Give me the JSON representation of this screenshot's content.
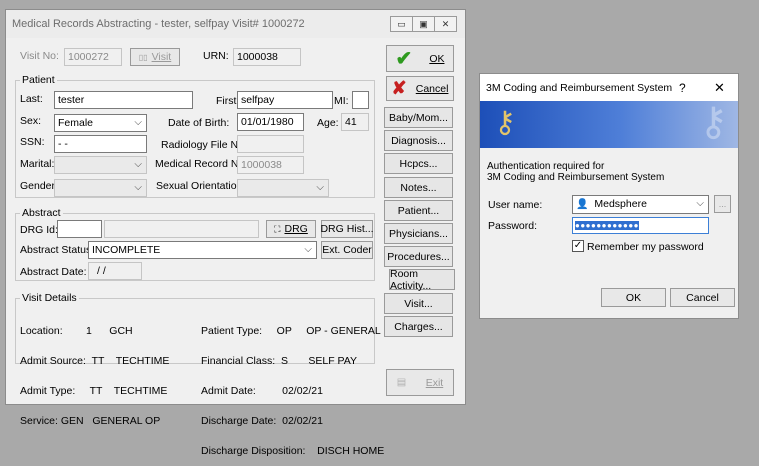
{
  "main_window": {
    "title": "Medical Records Abstracting - tester, selfpay  Visit# 1000272",
    "visit_no_label": "Visit No:",
    "visit_no_value": "1000272",
    "visit_button": "Visit",
    "urn_label": "URN:",
    "urn_value": "1000038",
    "patient": {
      "group_label": "Patient",
      "last_label": "Last:",
      "last_value": "tester",
      "first_label": "First:",
      "first_value": "selfpay",
      "mi_label": "MI:",
      "mi_value": "",
      "sex_label": "Sex:",
      "sex_value": "Female",
      "dob_label": "Date of Birth:",
      "dob_value": "01/01/1980",
      "age_label": "Age:",
      "age_value": "41",
      "ssn_label": "SSN:",
      "ssn_value": "- -",
      "radiology_label": "Radiology File No:",
      "radiology_value": "",
      "marital_label": "Marital:",
      "mrn_label": "Medical Record No:",
      "mrn_value": "1000038",
      "gender_label": "Gender:",
      "orientation_label": "Sexual Orientation:"
    },
    "abstract": {
      "group_label": "Abstract",
      "drg_id_label": "DRG Id:",
      "drg_button": "DRG",
      "drg_hist_button": "DRG Hist...",
      "status_label": "Abstract Status:",
      "status_value": "INCOMPLETE",
      "ext_coder_button": "Ext. Coder",
      "date_label": "Abstract Date:",
      "date_value": "/ /"
    },
    "visit_details": {
      "group_label": "Visit Details",
      "left_lines": [
        "Location:        1      GCH",
        "Admit Source:  TT    TECHTIME",
        "Admit Type:     TT    TECHTIME",
        "Service: GEN   GENERAL OP"
      ],
      "right_lines": [
        "Patient Type:     OP     OP - GENERAL",
        "Financial Class:  S       SELF PAY",
        "Admit Date:         02/02/21",
        "Discharge Date:  02/02/21",
        "Discharge Disposition:    DISCH HOME"
      ]
    },
    "side_buttons": {
      "ok": "OK",
      "cancel": "Cancel",
      "baby_mom": "Baby/Mom...",
      "diagnosis": "Diagnosis...",
      "hcpcs": "Hcpcs...",
      "notes": "Notes...",
      "patient": "Patient...",
      "physicians": "Physicians...",
      "procedures": "Procedures...",
      "room_activity": "Room Activity...",
      "visit": "Visit...",
      "charges": "Charges...",
      "exit": "Exit"
    }
  },
  "dialog": {
    "title": "3M Coding and Reimbursement System",
    "help": "?",
    "close": "✕",
    "message_line1": "Authentication required for",
    "message_line2": "3M Coding and Reimbursement System",
    "username_label": "User name:",
    "username_value": "Medsphere",
    "browse_button": "...",
    "password_label": "Password:",
    "password_value": "●●●●●●●●●●●●",
    "remember_label": "Remember my password",
    "ok_button": "OK",
    "cancel_button": "Cancel"
  }
}
